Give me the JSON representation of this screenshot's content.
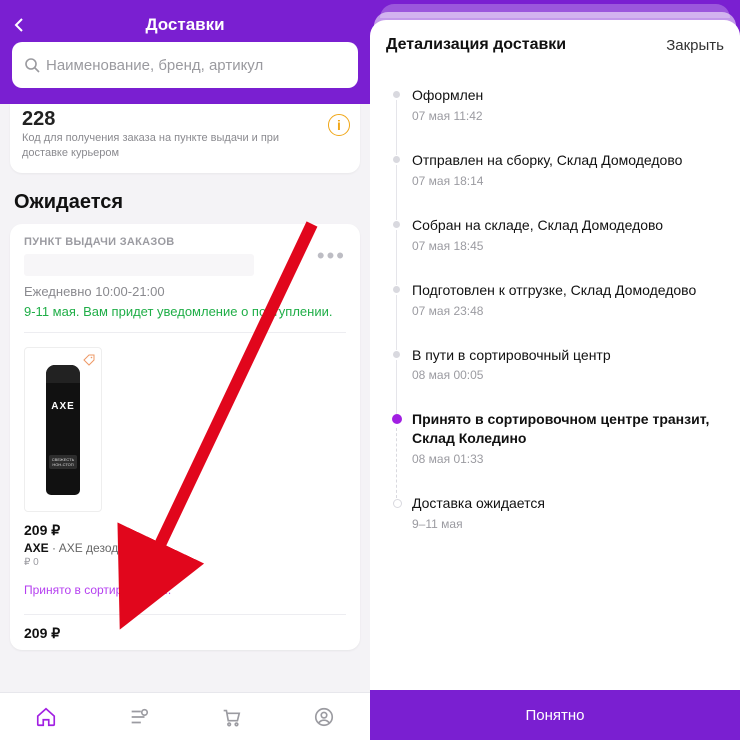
{
  "left": {
    "header": {
      "title": "Доставки"
    },
    "search": {
      "placeholder": "Наименование, бренд, артикул"
    },
    "code_card": {
      "code": "228",
      "desc": "Код для получения заказа на пункте выдачи и при доставке курьером"
    },
    "section_title": "Ожидается",
    "pickup": {
      "label": "ПУНКТ ВЫДАЧИ ЗАКАЗОВ",
      "schedule": "Ежедневно 10:00-21:00",
      "eta": "9-11 мая. Вам придет уведомление о поступлении."
    },
    "product": {
      "price": "209 ₽",
      "brand": "AXE",
      "name_rest": " · AXE дезод..",
      "refund": "₽ 0",
      "status": "Принято в сортировочно...",
      "thumb_brand": "AXE",
      "thumb_mid": "СВЕЖЕСТЬ\nНОН-СТОП"
    },
    "sum": "209 ₽",
    "tabs": [
      "home",
      "search",
      "cart",
      "profile"
    ]
  },
  "right": {
    "title": "Детализация доставки",
    "close": "Закрыть",
    "events": [
      {
        "title": "Оформлен",
        "time": "07 мая 11:42",
        "state": "past"
      },
      {
        "title": "Отправлен на сборку, Склад Домодедово",
        "time": "07 мая 18:14",
        "state": "past"
      },
      {
        "title": "Собран на складе, Склад Домодедово",
        "time": "07 мая 18:45",
        "state": "past"
      },
      {
        "title": "Подготовлен к отгрузке, Склад Домодедово",
        "time": "07 мая 23:48",
        "state": "past"
      },
      {
        "title": "В пути в сортировочный центр",
        "time": "08 мая 00:05",
        "state": "past"
      },
      {
        "title": "Принято в сортировочном центре транзит, Склад Коледино",
        "time": "08 мая 01:33",
        "state": "current"
      },
      {
        "title": "Доставка ожидается",
        "time": "9–11 мая",
        "state": "future"
      }
    ],
    "ok": "Понятно"
  },
  "colors": {
    "purple": "#7a1fd1",
    "accent": "#a11fe2",
    "green": "#1fae47"
  }
}
